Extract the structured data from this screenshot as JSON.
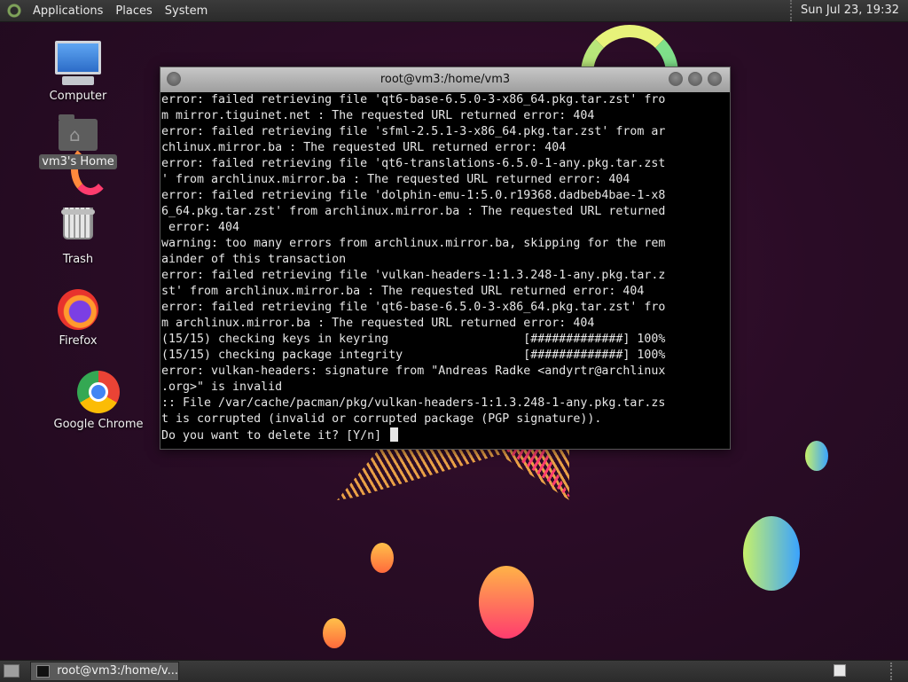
{
  "top_panel": {
    "menus": [
      "Applications",
      "Places",
      "System"
    ],
    "clock": "Sun Jul 23, 19:32"
  },
  "desktop_icons": [
    {
      "label": "Computer",
      "icon": "computer-icon"
    },
    {
      "label": "vm3's Home",
      "icon": "home-folder-icon"
    },
    {
      "label": "Trash",
      "icon": "trash-icon"
    },
    {
      "label": "Firefox",
      "icon": "firefox-icon"
    },
    {
      "label": "Google Chrome",
      "icon": "chrome-icon"
    }
  ],
  "terminal": {
    "title": "root@vm3:/home/vm3",
    "lines": [
      "error: failed retrieving file 'qt6-base-6.5.0-3-x86_64.pkg.tar.zst' fro",
      "m mirror.tiguinet.net : The requested URL returned error: 404",
      "error: failed retrieving file 'sfml-2.5.1-3-x86_64.pkg.tar.zst' from ar",
      "chlinux.mirror.ba : The requested URL returned error: 404",
      "error: failed retrieving file 'qt6-translations-6.5.0-1-any.pkg.tar.zst",
      "' from archlinux.mirror.ba : The requested URL returned error: 404",
      "error: failed retrieving file 'dolphin-emu-1:5.0.r19368.dadbeb4bae-1-x8",
      "6_64.pkg.tar.zst' from archlinux.mirror.ba : The requested URL returned",
      " error: 404",
      "warning: too many errors from archlinux.mirror.ba, skipping for the rem",
      "ainder of this transaction",
      "error: failed retrieving file 'vulkan-headers-1:1.3.248-1-any.pkg.tar.z",
      "st' from archlinux.mirror.ba : The requested URL returned error: 404",
      "error: failed retrieving file 'qt6-base-6.5.0-3-x86_64.pkg.tar.zst' fro",
      "m archlinux.mirror.ba : The requested URL returned error: 404",
      "(15/15) checking keys in keyring                   [#############] 100%",
      "(15/15) checking package integrity                 [#############] 100%",
      "error: vulkan-headers: signature from \"Andreas Radke <andyrtr@archlinux",
      ".org>\" is invalid",
      ":: File /var/cache/pacman/pkg/vulkan-headers-1:1.3.248-1-any.pkg.tar.zs",
      "t is corrupted (invalid or corrupted package (PGP signature)).",
      "Do you want to delete it? [Y/n] "
    ]
  },
  "taskbar": {
    "tasks": [
      {
        "label": "root@vm3:/home/v...",
        "icon": "terminal-icon"
      }
    ]
  }
}
